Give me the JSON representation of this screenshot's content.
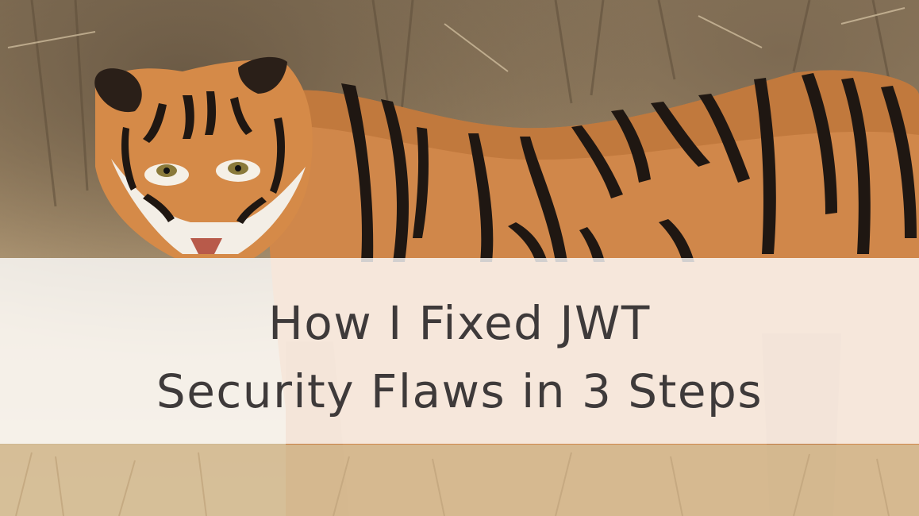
{
  "banner": {
    "title_lines": [
      "How I Fixed JWT",
      "Security Flaws in 3 Steps"
    ]
  },
  "photo": {
    "subject": "tiger-photo"
  },
  "colors": {
    "band": "#ffffff",
    "title_text": "#3e3a3a",
    "tiger_fur": "#d0874a",
    "tiger_stripe": "#1f1712",
    "grass": "#d6bf98"
  }
}
